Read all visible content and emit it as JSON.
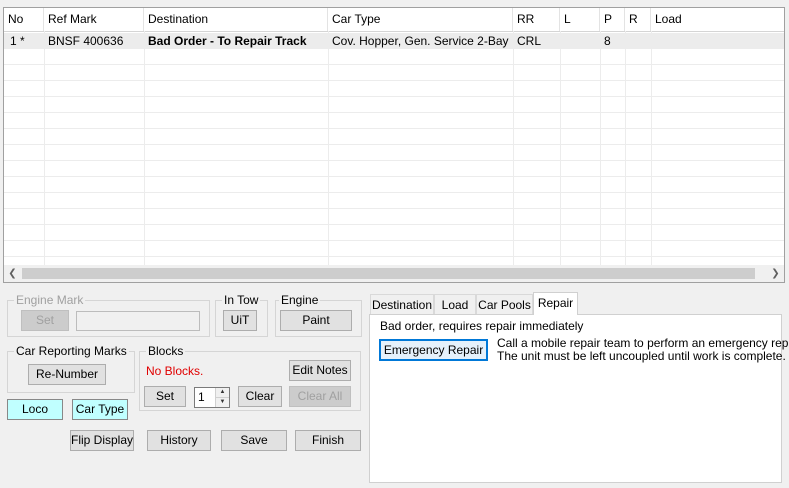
{
  "grid": {
    "columns": [
      "No",
      "Ref Mark",
      "Destination",
      "Car Type",
      "RR",
      "L",
      "P",
      "R",
      "Load"
    ],
    "rows": [
      {
        "no": "1 *",
        "ref_mark": "BNSF 400636",
        "destination": "Bad Order - To Repair Track",
        "car_type": "Cov. Hopper, Gen. Service 2-Bay",
        "rr": "CRL",
        "l": "",
        "p": "8",
        "r": "",
        "load": ""
      }
    ],
    "scroll_left_icon": "chevron-left-icon",
    "scroll_right_icon": "chevron-right-icon"
  },
  "engine_mark": {
    "label": "Engine Mark",
    "set_label": "Set",
    "value": ""
  },
  "in_tow": {
    "label": "In Tow",
    "uit_label": "UiT"
  },
  "engine": {
    "label": "Engine",
    "paint_label": "Paint"
  },
  "car_reporting_marks": {
    "label": "Car Reporting Marks",
    "renumber_label": "Re-Number"
  },
  "blocks": {
    "label": "Blocks",
    "status": "No Blocks.",
    "status_color": "#e00000",
    "edit_notes_label": "Edit Notes",
    "set_label": "Set",
    "spinner_value": "1",
    "clear_label": "Clear",
    "clear_all_label": "Clear All"
  },
  "toggles": {
    "loco_label": "Loco",
    "car_type_label": "Car Type",
    "accent": "#c0ffff"
  },
  "bottom_buttons": {
    "flip_display": "Flip Display",
    "history": "History",
    "save": "Save",
    "finish": "Finish"
  },
  "tabs": [
    "Destination",
    "Load",
    "Car Pools",
    "Repair"
  ],
  "active_tab": "Repair",
  "repair": {
    "heading": "Bad order, requires repair immediately",
    "emergency_label": "Emergency Repair",
    "desc_line1": "Call a mobile repair team to perform an emergency repair.",
    "desc_line2": "The unit must be left uncoupled until work is complete."
  }
}
